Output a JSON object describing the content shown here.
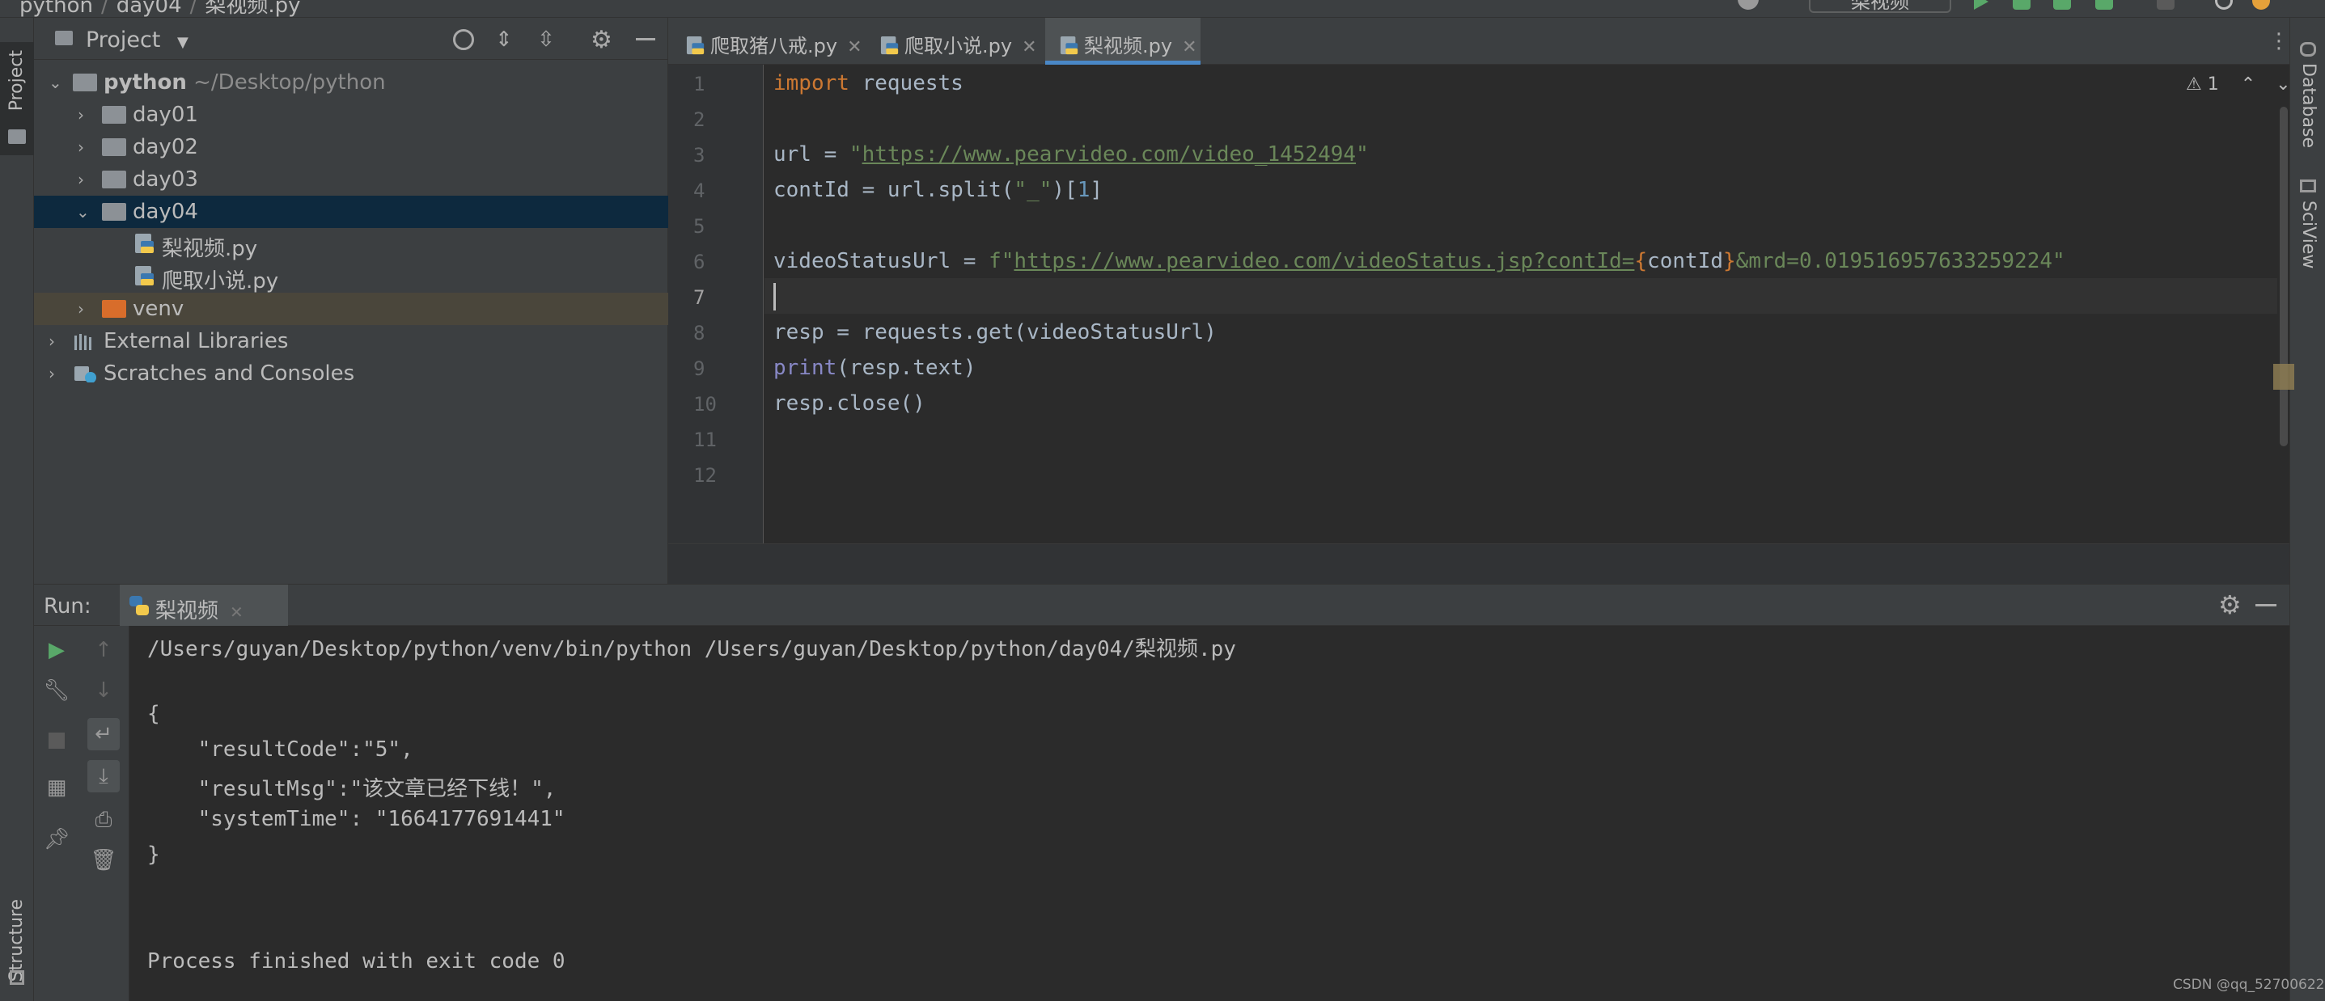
{
  "breadcrumb": [
    "python",
    "day04",
    "梨视频.py"
  ],
  "run_config": "梨视频",
  "tool_windows": {
    "project": "Project",
    "structure": "Structure",
    "database": "Database",
    "sciview": "SciView"
  },
  "project_panel": {
    "title": "Project",
    "tree": [
      {
        "label": "python",
        "hint": "~/Desktop/python",
        "type": "root"
      },
      {
        "label": "day01",
        "type": "folder"
      },
      {
        "label": "day02",
        "type": "folder"
      },
      {
        "label": "day03",
        "type": "folder"
      },
      {
        "label": "day04",
        "type": "folder-open"
      },
      {
        "label": "梨视频.py",
        "type": "file"
      },
      {
        "label": "爬取小说.py",
        "type": "file"
      },
      {
        "label": "venv",
        "type": "venv"
      },
      {
        "label": "External Libraries",
        "type": "libraries"
      },
      {
        "label": "Scratches and Consoles",
        "type": "scratches"
      }
    ]
  },
  "editor": {
    "tabs": [
      {
        "label": "爬取猪八戒.py",
        "active": false
      },
      {
        "label": "爬取小说.py",
        "active": false
      },
      {
        "label": "梨视频.py",
        "active": true
      }
    ],
    "warnings": "1",
    "line_numbers": [
      "1",
      "2",
      "3",
      "4",
      "5",
      "6",
      "7",
      "8",
      "9",
      "10",
      "11",
      "12"
    ],
    "current_line": "7",
    "code": {
      "l1_kw": "import",
      "l1_rest": " requests",
      "l3_var": "url = ",
      "l3_q1": "\"",
      "l3_url": "https://www.pearvideo.com/video_1452494",
      "l3_q2": "\"",
      "l4_a": "contId = url.split(",
      "l4_str": "\"_\"",
      "l4_b": ")[",
      "l4_num": "1",
      "l4_c": "]",
      "l6_var": "videoStatusUrl = ",
      "l6_prefix": "f\"",
      "l6_url": "https://www.pearvideo.com/videoStatus.jsp?contId=",
      "l6_lb": "{",
      "l6_expr": "contId",
      "l6_rb": "}",
      "l6_tail": "&mrd=0.019516957633259224\"",
      "l8": "resp = requests.get(videoStatusUrl)",
      "l9_fn": "print",
      "l9_rest": "(resp.text)",
      "l10": "resp.close()"
    }
  },
  "run": {
    "label": "Run:",
    "tab": "梨视频",
    "output": [
      "/Users/guyan/Desktop/python/venv/bin/python /Users/guyan/Desktop/python/day04/梨视频.py",
      "{",
      "    \"resultCode\":\"5\",",
      "    \"resultMsg\":\"该文章已经下线！\",",
      "    \"systemTime\": \"1664177691441\"",
      "}",
      "Process finished with exit code 0"
    ]
  },
  "watermark": "CSDN @qq_52700622"
}
